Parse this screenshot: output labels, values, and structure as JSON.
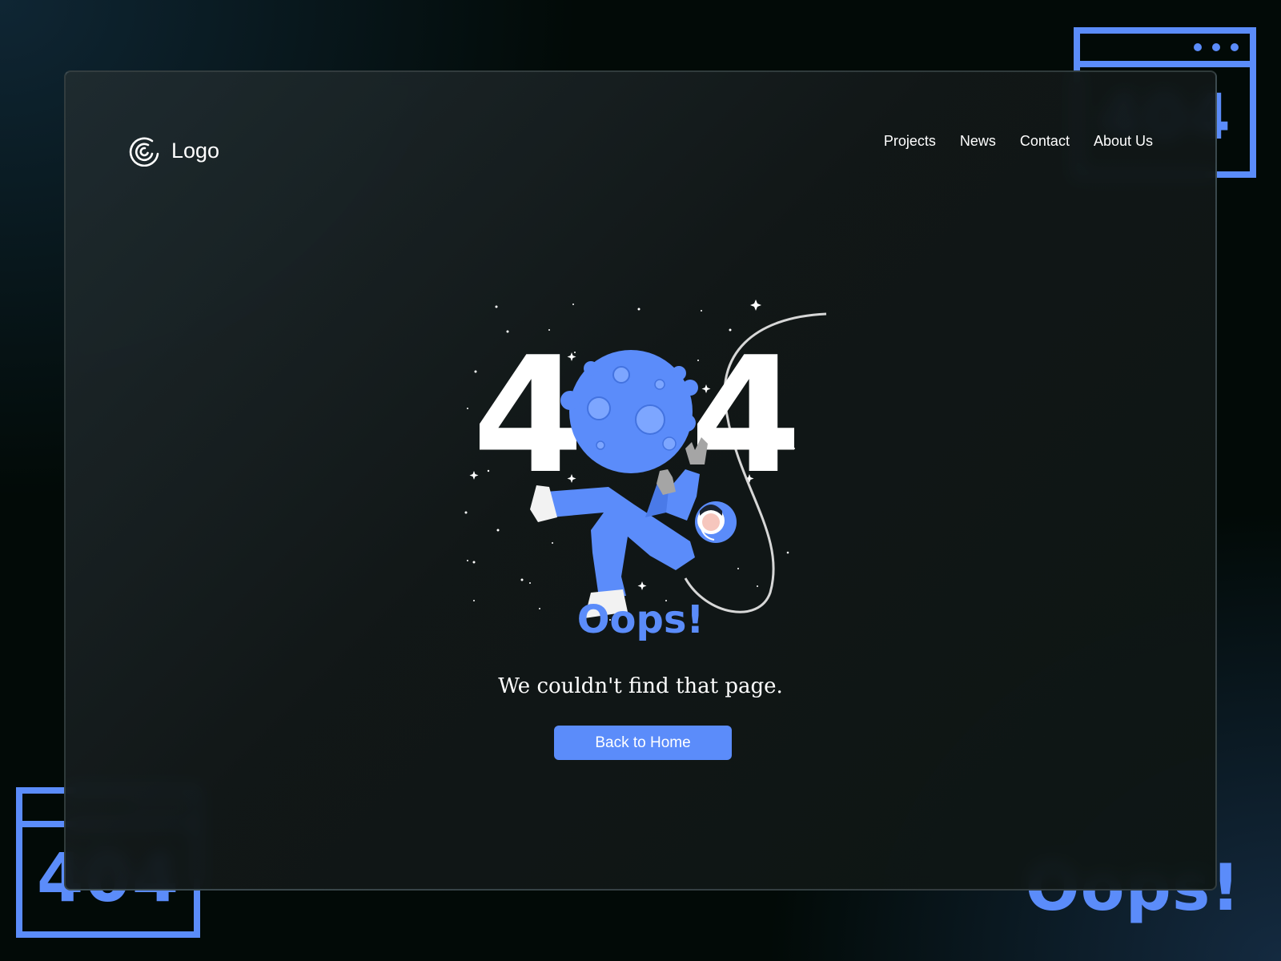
{
  "theme": {
    "accent": "#5b8cfa",
    "background": "#020a07",
    "text": "#ffffff"
  },
  "header": {
    "logo_icon": "spiral-logo-icon",
    "logo_label": "Logo",
    "nav": [
      {
        "label": "Projects"
      },
      {
        "label": "News"
      },
      {
        "label": "Contact"
      },
      {
        "label": "About Us"
      }
    ]
  },
  "illustration": {
    "digit_left": "4",
    "digit_right": "4",
    "icon": "astronaut-moon-illustration"
  },
  "content": {
    "title": "Oops!",
    "message": "We couldn't find that page.",
    "button_label": "Back to Home"
  },
  "decor": {
    "window_top_text": "404",
    "window_bottom_text": "404",
    "corner_text": "Oops!"
  }
}
